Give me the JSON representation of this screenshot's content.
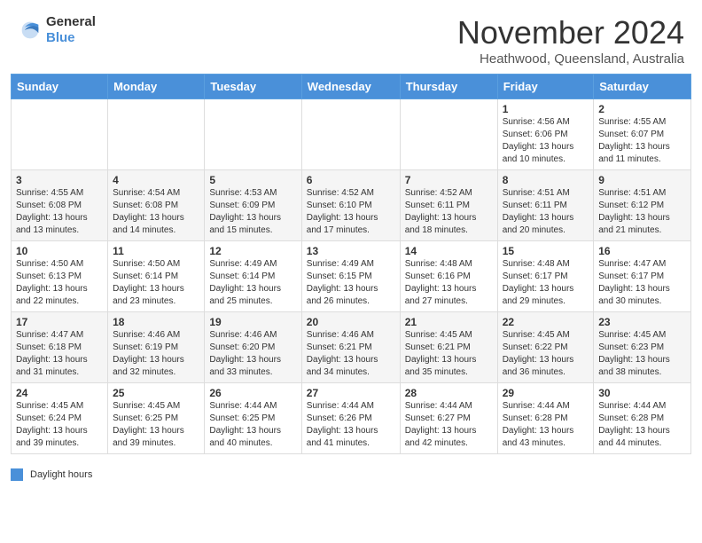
{
  "header": {
    "logo_line1": "General",
    "logo_line2": "Blue",
    "month_title": "November 2024",
    "location": "Heathwood, Queensland, Australia"
  },
  "days_of_week": [
    "Sunday",
    "Monday",
    "Tuesday",
    "Wednesday",
    "Thursday",
    "Friday",
    "Saturday"
  ],
  "legend_label": "Daylight hours",
  "weeks": [
    [
      {
        "day": "",
        "info": ""
      },
      {
        "day": "",
        "info": ""
      },
      {
        "day": "",
        "info": ""
      },
      {
        "day": "",
        "info": ""
      },
      {
        "day": "",
        "info": ""
      },
      {
        "day": "1",
        "info": "Sunrise: 4:56 AM\nSunset: 6:06 PM\nDaylight: 13 hours\nand 10 minutes."
      },
      {
        "day": "2",
        "info": "Sunrise: 4:55 AM\nSunset: 6:07 PM\nDaylight: 13 hours\nand 11 minutes."
      }
    ],
    [
      {
        "day": "3",
        "info": "Sunrise: 4:55 AM\nSunset: 6:08 PM\nDaylight: 13 hours\nand 13 minutes."
      },
      {
        "day": "4",
        "info": "Sunrise: 4:54 AM\nSunset: 6:08 PM\nDaylight: 13 hours\nand 14 minutes."
      },
      {
        "day": "5",
        "info": "Sunrise: 4:53 AM\nSunset: 6:09 PM\nDaylight: 13 hours\nand 15 minutes."
      },
      {
        "day": "6",
        "info": "Sunrise: 4:52 AM\nSunset: 6:10 PM\nDaylight: 13 hours\nand 17 minutes."
      },
      {
        "day": "7",
        "info": "Sunrise: 4:52 AM\nSunset: 6:11 PM\nDaylight: 13 hours\nand 18 minutes."
      },
      {
        "day": "8",
        "info": "Sunrise: 4:51 AM\nSunset: 6:11 PM\nDaylight: 13 hours\nand 20 minutes."
      },
      {
        "day": "9",
        "info": "Sunrise: 4:51 AM\nSunset: 6:12 PM\nDaylight: 13 hours\nand 21 minutes."
      }
    ],
    [
      {
        "day": "10",
        "info": "Sunrise: 4:50 AM\nSunset: 6:13 PM\nDaylight: 13 hours\nand 22 minutes."
      },
      {
        "day": "11",
        "info": "Sunrise: 4:50 AM\nSunset: 6:14 PM\nDaylight: 13 hours\nand 23 minutes."
      },
      {
        "day": "12",
        "info": "Sunrise: 4:49 AM\nSunset: 6:14 PM\nDaylight: 13 hours\nand 25 minutes."
      },
      {
        "day": "13",
        "info": "Sunrise: 4:49 AM\nSunset: 6:15 PM\nDaylight: 13 hours\nand 26 minutes."
      },
      {
        "day": "14",
        "info": "Sunrise: 4:48 AM\nSunset: 6:16 PM\nDaylight: 13 hours\nand 27 minutes."
      },
      {
        "day": "15",
        "info": "Sunrise: 4:48 AM\nSunset: 6:17 PM\nDaylight: 13 hours\nand 29 minutes."
      },
      {
        "day": "16",
        "info": "Sunrise: 4:47 AM\nSunset: 6:17 PM\nDaylight: 13 hours\nand 30 minutes."
      }
    ],
    [
      {
        "day": "17",
        "info": "Sunrise: 4:47 AM\nSunset: 6:18 PM\nDaylight: 13 hours\nand 31 minutes."
      },
      {
        "day": "18",
        "info": "Sunrise: 4:46 AM\nSunset: 6:19 PM\nDaylight: 13 hours\nand 32 minutes."
      },
      {
        "day": "19",
        "info": "Sunrise: 4:46 AM\nSunset: 6:20 PM\nDaylight: 13 hours\nand 33 minutes."
      },
      {
        "day": "20",
        "info": "Sunrise: 4:46 AM\nSunset: 6:21 PM\nDaylight: 13 hours\nand 34 minutes."
      },
      {
        "day": "21",
        "info": "Sunrise: 4:45 AM\nSunset: 6:21 PM\nDaylight: 13 hours\nand 35 minutes."
      },
      {
        "day": "22",
        "info": "Sunrise: 4:45 AM\nSunset: 6:22 PM\nDaylight: 13 hours\nand 36 minutes."
      },
      {
        "day": "23",
        "info": "Sunrise: 4:45 AM\nSunset: 6:23 PM\nDaylight: 13 hours\nand 38 minutes."
      }
    ],
    [
      {
        "day": "24",
        "info": "Sunrise: 4:45 AM\nSunset: 6:24 PM\nDaylight: 13 hours\nand 39 minutes."
      },
      {
        "day": "25",
        "info": "Sunrise: 4:45 AM\nSunset: 6:25 PM\nDaylight: 13 hours\nand 39 minutes."
      },
      {
        "day": "26",
        "info": "Sunrise: 4:44 AM\nSunset: 6:25 PM\nDaylight: 13 hours\nand 40 minutes."
      },
      {
        "day": "27",
        "info": "Sunrise: 4:44 AM\nSunset: 6:26 PM\nDaylight: 13 hours\nand 41 minutes."
      },
      {
        "day": "28",
        "info": "Sunrise: 4:44 AM\nSunset: 6:27 PM\nDaylight: 13 hours\nand 42 minutes."
      },
      {
        "day": "29",
        "info": "Sunrise: 4:44 AM\nSunset: 6:28 PM\nDaylight: 13 hours\nand 43 minutes."
      },
      {
        "day": "30",
        "info": "Sunrise: 4:44 AM\nSunset: 6:28 PM\nDaylight: 13 hours\nand 44 minutes."
      }
    ]
  ]
}
